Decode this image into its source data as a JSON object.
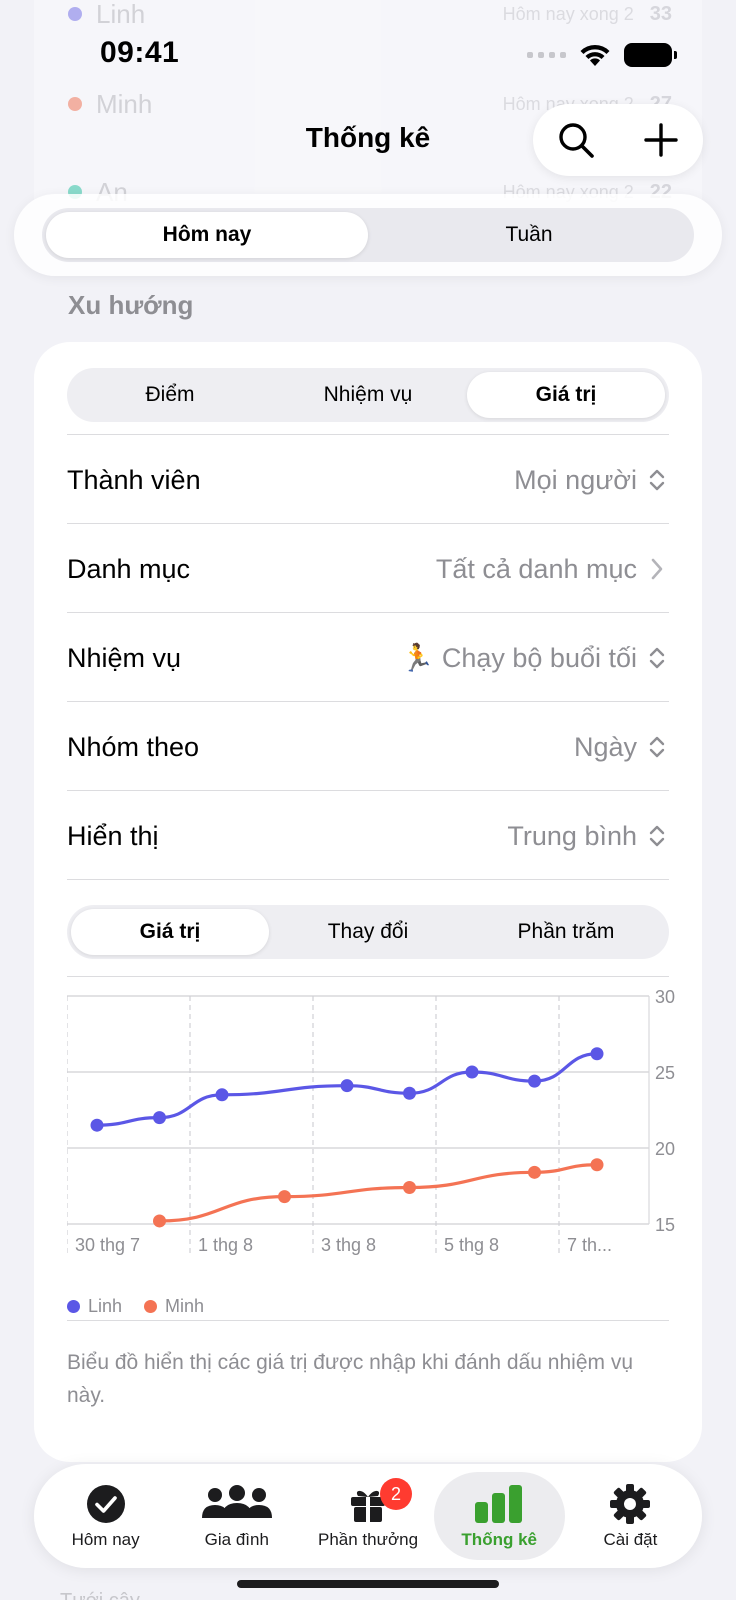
{
  "background_list": [
    {
      "name": "Linh",
      "sub": "Hôm nay xong 2",
      "count": "33",
      "color": "#7b78ea"
    },
    {
      "name": "Minh",
      "sub": "Hôm nay xong 2",
      "count": "27",
      "color": "#f27b5e"
    },
    {
      "name": "An",
      "sub": "Hôm nay xong 2",
      "count": "22",
      "color": "#34c7a8"
    }
  ],
  "status": {
    "time": "09:41"
  },
  "header": {
    "title": "Thống kê"
  },
  "period_tabs": [
    {
      "label": "Hôm nay",
      "active": true
    },
    {
      "label": "Tuần",
      "active": false
    }
  ],
  "section": {
    "title": "Xu hướng"
  },
  "metric_tabs": [
    {
      "label": "Điểm",
      "active": false
    },
    {
      "label": "Nhiệm vụ",
      "active": false
    },
    {
      "label": "Giá trị",
      "active": true
    }
  ],
  "filters": [
    {
      "label": "Thành viên",
      "value": "Mọi người",
      "chevron": "updown-chevron-icon"
    },
    {
      "label": "Danh mục",
      "value": "Tất cả danh mục",
      "chevron": "chevron-right-icon"
    },
    {
      "label": "Nhiệm vụ",
      "value": "🏃 Chạy bộ buổi tối",
      "chevron": "updown-chevron-icon"
    },
    {
      "label": "Nhóm theo",
      "value": "Ngày",
      "chevron": "updown-chevron-icon"
    },
    {
      "label": "Hiển thị",
      "value": "Trung bình",
      "chevron": "updown-chevron-icon"
    }
  ],
  "display_tabs": [
    {
      "label": "Giá trị",
      "active": true
    },
    {
      "label": "Thay đổi",
      "active": false
    },
    {
      "label": "Phần trăm",
      "active": false
    }
  ],
  "chart_data": {
    "type": "line",
    "x": [
      "30 thg 7",
      "31 thg 7",
      "1 thg 8",
      "2 thg 8",
      "3 thg 8",
      "4 thg 8",
      "5 thg 8",
      "6 thg 8",
      "7 thg 8"
    ],
    "x_tick_labels": [
      "30 thg 7",
      "1 thg 8",
      "3 thg 8",
      "5 thg 8",
      "7 th..."
    ],
    "series": [
      {
        "name": "Linh",
        "color": "#5b57e6",
        "values": [
          21.5,
          22.0,
          23.5,
          null,
          24.1,
          23.6,
          25.0,
          24.4,
          26.2
        ]
      },
      {
        "name": "Minh",
        "color": "#f47354",
        "values": [
          null,
          15.2,
          null,
          16.8,
          null,
          17.4,
          null,
          18.4,
          18.9
        ]
      }
    ],
    "yticks": [
      15,
      20,
      25,
      30
    ],
    "ylim": [
      15,
      30
    ],
    "grid": true,
    "legend": "bottom-left"
  },
  "caption": "Biểu đồ hiển thị các giá trị được nhập khi đánh dấu nhiệm vụ này.",
  "faded_bottom_text": "Tưới cây",
  "tabbar": [
    {
      "label": "Hôm nay",
      "icon": "checkmark-circle-icon",
      "active": false,
      "badge": ""
    },
    {
      "label": "Gia đình",
      "icon": "people-icon",
      "active": false,
      "badge": ""
    },
    {
      "label": "Phần thưởng",
      "icon": "gift-icon",
      "active": false,
      "badge": "2"
    },
    {
      "label": "Thống kê",
      "icon": "bar-chart-icon",
      "active": true,
      "badge": ""
    },
    {
      "label": "Cài đặt",
      "icon": "gear-icon",
      "active": false,
      "badge": ""
    }
  ]
}
